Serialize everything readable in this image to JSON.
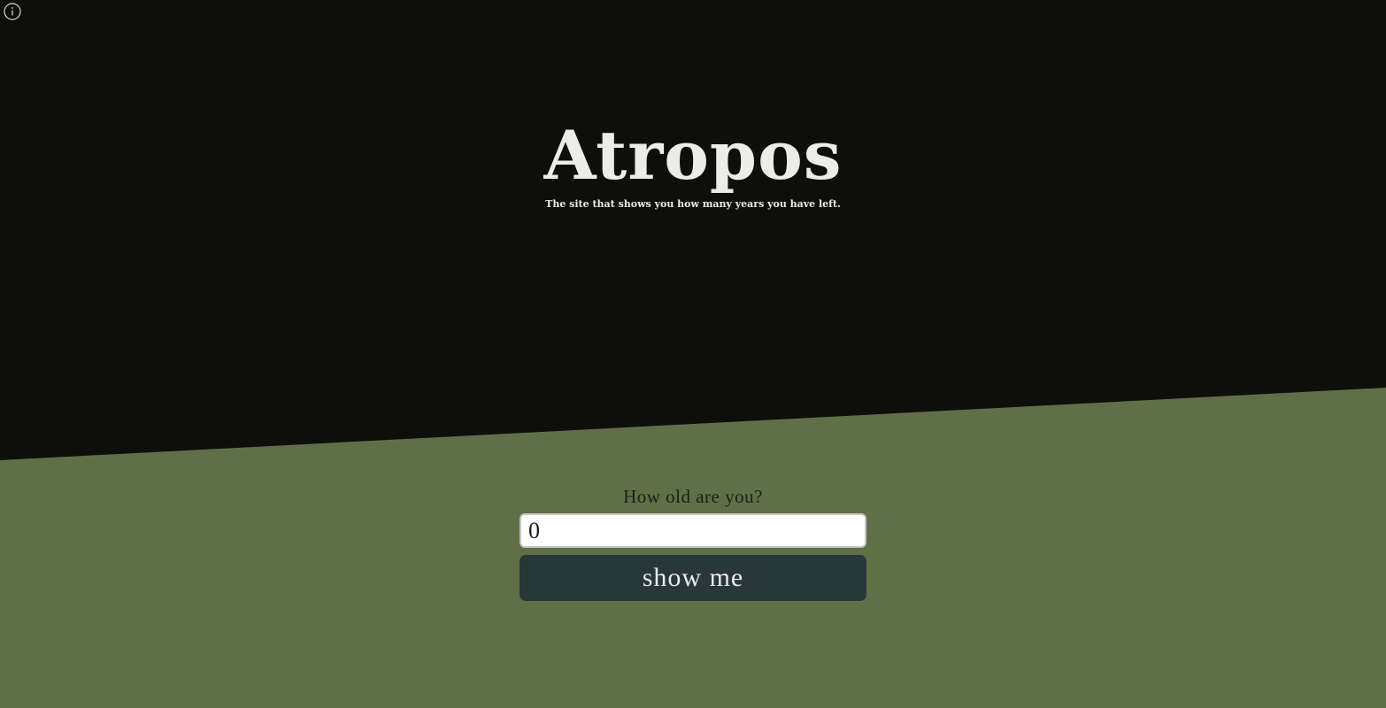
{
  "header": {
    "info_icon": "info-icon"
  },
  "hero": {
    "title": "Atropos",
    "subtitle": "The site that shows you how many years you have left."
  },
  "form": {
    "question": "How old are you?",
    "age_value": "0",
    "submit_label": "show me"
  },
  "colors": {
    "background_dark": "#0e0f0d",
    "background_green": "#5f7047",
    "button": "#283739",
    "title_text": "#ececea"
  }
}
